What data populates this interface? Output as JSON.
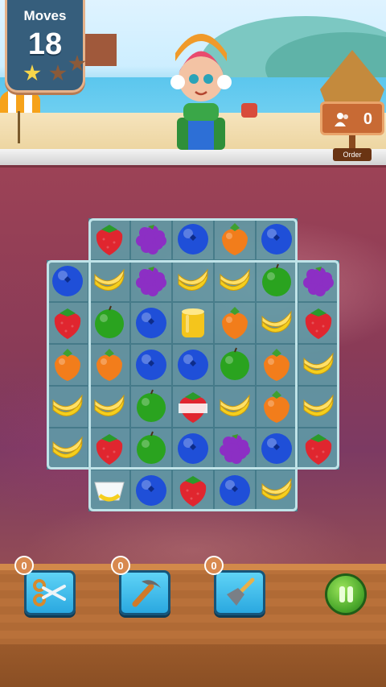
{
  "hud": {
    "moves_label": "Moves",
    "moves_value": "18",
    "stars_earned": 1,
    "stars_total": 3,
    "order_count": "0",
    "order_label": "Order"
  },
  "boosters": [
    {
      "name": "scissors",
      "count": "0"
    },
    {
      "name": "hammer",
      "count": "0"
    },
    {
      "name": "shovel",
      "count": "0"
    }
  ],
  "board": {
    "cols": 7,
    "rows": 7,
    "grid": [
      [
        "",
        "strawberry",
        "grape",
        "blueberry",
        "orange",
        "blueberry",
        ""
      ],
      [
        "blueberry",
        "banana",
        "grape",
        "banana",
        "banana",
        "apple",
        "grape"
      ],
      [
        "strawberry",
        "apple",
        "blueberry",
        "jelly",
        "orange",
        "banana",
        "strawberry"
      ],
      [
        "orange",
        "orange",
        "blueberry",
        "blueberry",
        "apple",
        "orange",
        "banana"
      ],
      [
        "banana",
        "banana",
        "apple",
        "wrapped-strawberry",
        "banana",
        "orange",
        "banana"
      ],
      [
        "banana",
        "strawberry",
        "apple",
        "blueberry",
        "grape",
        "blueberry",
        "strawberry"
      ],
      [
        "",
        "wrapped-banana",
        "blueberry",
        "strawberry",
        "blueberry",
        "banana",
        ""
      ]
    ]
  },
  "colors": {
    "strawberry": "#e0262f",
    "grape": "#8c2fc4",
    "blueberry": "#1f4fd8",
    "orange": "#f27d1b",
    "banana": "#f5cf1d",
    "apple": "#2aa31f",
    "jelly": "#f4c51c"
  }
}
